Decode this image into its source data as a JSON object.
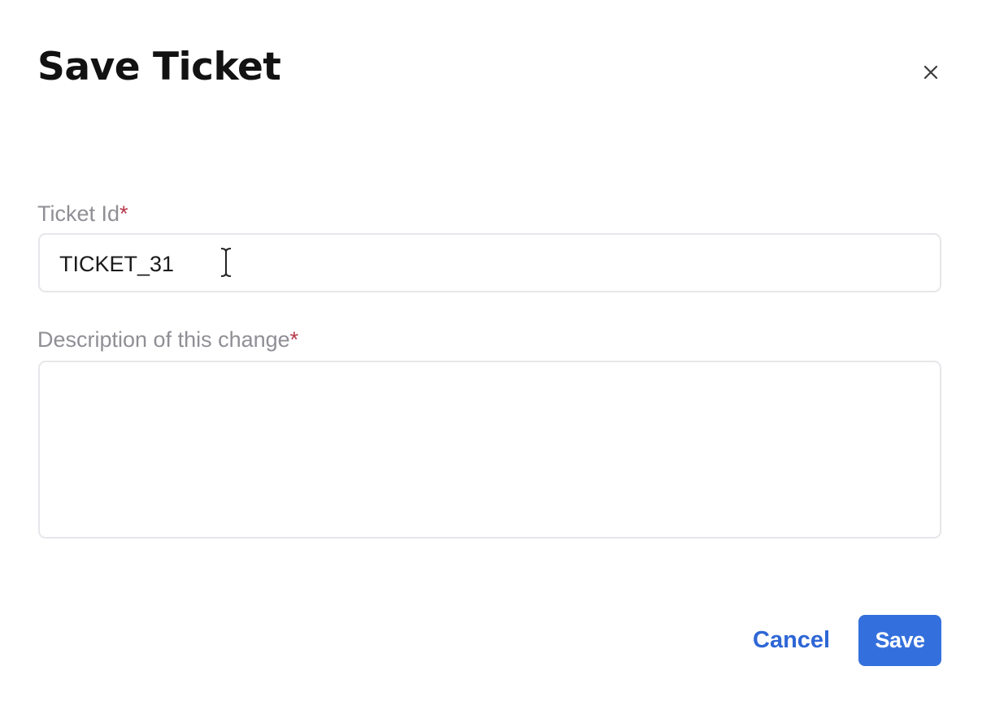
{
  "dialog": {
    "title": "Save Ticket",
    "close_icon": "close-icon"
  },
  "fields": {
    "ticket_id": {
      "label": "Ticket Id",
      "required_mark": "*",
      "value": "TICKET_31"
    },
    "description": {
      "label": "Description of this change",
      "required_mark": "*",
      "value": ""
    }
  },
  "actions": {
    "cancel_label": "Cancel",
    "save_label": "Save"
  },
  "colors": {
    "primary": "#3470dd",
    "link": "#2e66d6",
    "required": "#b5384a",
    "label": "#8f8f95",
    "border": "#e6e7ea"
  }
}
